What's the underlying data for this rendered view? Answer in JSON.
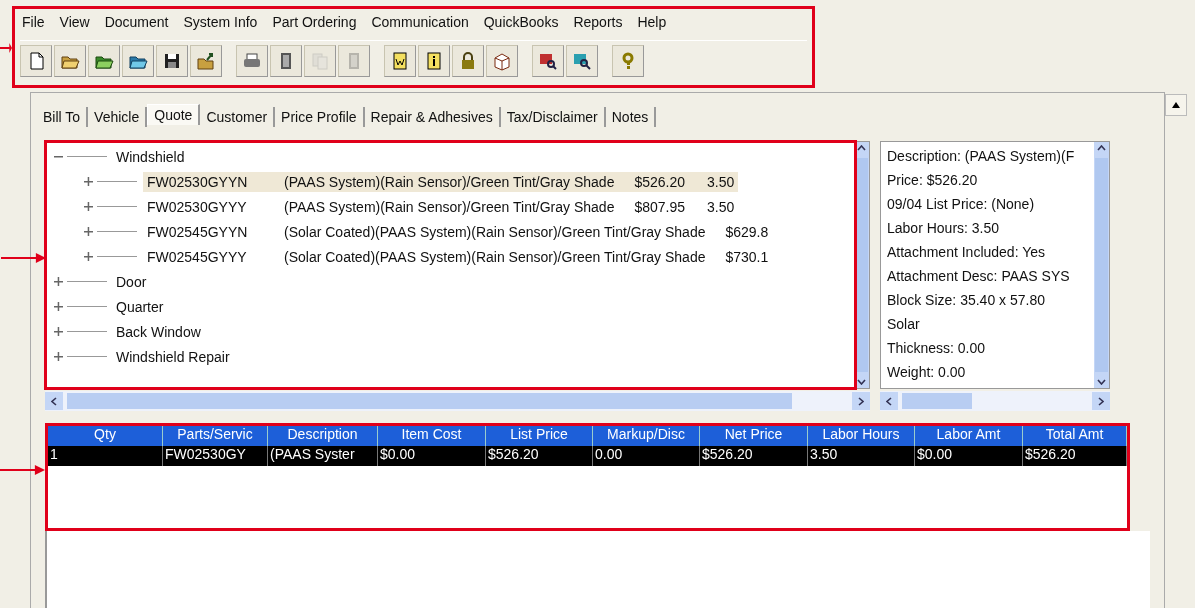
{
  "menu_area": {
    "highlighted": true,
    "menu": [
      "File",
      "View",
      "Document",
      "System Info",
      "Part Ordering",
      "Communication",
      "QuickBooks",
      "Reports",
      "Help"
    ],
    "toolbar": [
      [
        {
          "kind": "new",
          "disabled": false
        },
        {
          "kind": "open",
          "disabled": false
        },
        {
          "kind": "open-green",
          "disabled": false
        },
        {
          "kind": "open-blue",
          "disabled": false
        },
        {
          "kind": "save",
          "disabled": false
        },
        {
          "kind": "export",
          "disabled": false
        }
      ],
      [
        {
          "kind": "print",
          "disabled": false
        },
        {
          "kind": "calc",
          "disabled": false
        },
        {
          "kind": "copy",
          "disabled": true
        },
        {
          "kind": "calc",
          "disabled": true
        }
      ],
      [
        {
          "kind": "doc",
          "disabled": false
        },
        {
          "kind": "info",
          "disabled": false
        },
        {
          "kind": "lock",
          "disabled": false
        },
        {
          "kind": "box",
          "disabled": false
        }
      ],
      [
        {
          "kind": "screen",
          "disabled": false
        },
        {
          "kind": "find",
          "disabled": false
        }
      ],
      [
        {
          "kind": "help",
          "disabled": false
        }
      ]
    ]
  },
  "tabs": [
    {
      "label": "Bill To",
      "selected": false
    },
    {
      "label": "Vehicle",
      "selected": false
    },
    {
      "label": "Quote",
      "selected": true
    },
    {
      "label": "Customer",
      "selected": false
    },
    {
      "label": "Price Profile",
      "selected": false
    },
    {
      "label": "Repair & Adhesives",
      "selected": false
    },
    {
      "label": "Tax/Disclaimer",
      "selected": false
    },
    {
      "label": "Notes",
      "selected": false
    }
  ],
  "tree": {
    "highlighted": true,
    "items": [
      {
        "label": "Windshield",
        "expanded": true,
        "children": [
          {
            "part": "FW02530GYYN",
            "description": "(PAAS System)(Rain Sensor)/Green Tint/Gray Shade",
            "price": "$526.20",
            "hours": "3.50",
            "selected": true
          },
          {
            "part": "FW02530GYYY",
            "description": "(PAAS System)(Rain Sensor)/Green Tint/Gray Shade",
            "price": "$807.95",
            "hours": "3.50",
            "selected": false
          },
          {
            "part": "FW02545GYYN",
            "description": "(Solar Coated)(PAAS System)(Rain Sensor)/Green Tint/Gray Shade",
            "price": "$629.8",
            "selected": false
          },
          {
            "part": "FW02545GYYY",
            "description": "(Solar Coated)(PAAS System)(Rain Sensor)/Green Tint/Gray Shade",
            "price": "$730.1",
            "selected": false
          }
        ]
      },
      {
        "label": "Door",
        "expanded": false
      },
      {
        "label": "Quarter",
        "expanded": false
      },
      {
        "label": "Back Window",
        "expanded": false
      },
      {
        "label": "Windshield Repair",
        "expanded": false
      }
    ]
  },
  "details": [
    "Description: (PAAS System)(F",
    "Price: $526.20",
    "09/04 List Price: (None)",
    "Labor Hours: 3.50",
    "Attachment Included: Yes",
    "Attachment Desc: PAAS SYS",
    "Block Size: 35.40 x 57.80",
    "Solar",
    "Thickness: 0.00",
    "Weight: 0.00"
  ],
  "table": {
    "highlighted": true,
    "columns": [
      "Qty",
      "Parts/Servic",
      "Description",
      "Item Cost",
      "List Price",
      "Markup/Disc",
      "Net Price",
      "Labor Hours",
      "Labor Amt",
      "Total Amt"
    ],
    "rows": [
      {
        "selected": true,
        "cells": [
          "1",
          "FW02530GY",
          "(PAAS Syster",
          "$0.00",
          "$526.20",
          "0.00",
          "$526.20",
          "3.50",
          "$0.00",
          "$526.20"
        ]
      }
    ]
  }
}
